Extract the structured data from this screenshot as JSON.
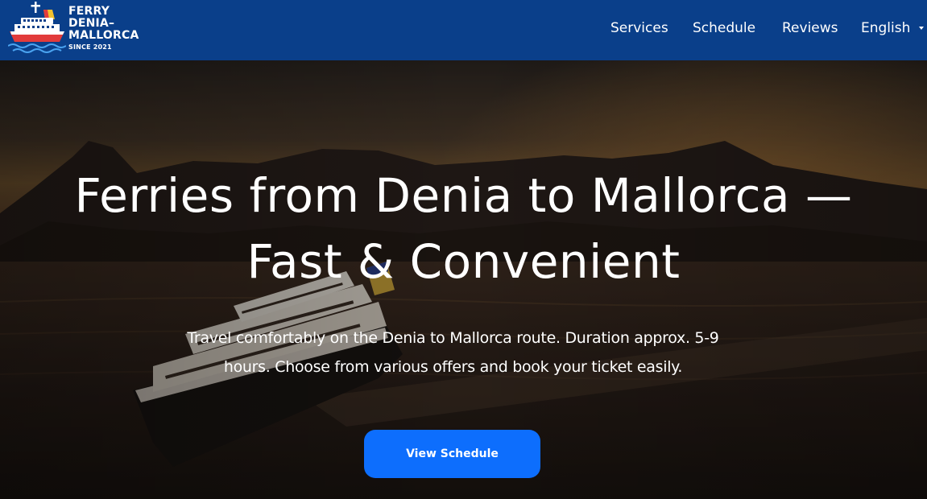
{
  "header": {
    "logo": {
      "line1": "FERRY",
      "line2": "DENIA–",
      "line3": "MALLORCA",
      "since": "SINCE 2021",
      "icon": "ferry-ship-icon"
    },
    "nav": [
      {
        "label": "Services"
      },
      {
        "label": "Schedule"
      },
      {
        "label": "Reviews"
      },
      {
        "label": "English",
        "icon": "caret-down-icon"
      }
    ]
  },
  "hero": {
    "title_line1": "Ferries from Denia to Mallorca —",
    "title_line2": "Fast & Convenient",
    "subtitle_line1": "Travel comfortably on the Denia to Mallorca route. Duration approx. 5-9",
    "subtitle_line2": "hours. Choose from various offers and book your ticket easily.",
    "cta_label": "View Schedule",
    "background": "ferry-at-sunset-photo"
  },
  "colors": {
    "header_bg": "#0a3f8a",
    "cta_bg": "#0d6efd",
    "text": "#ffffff"
  }
}
